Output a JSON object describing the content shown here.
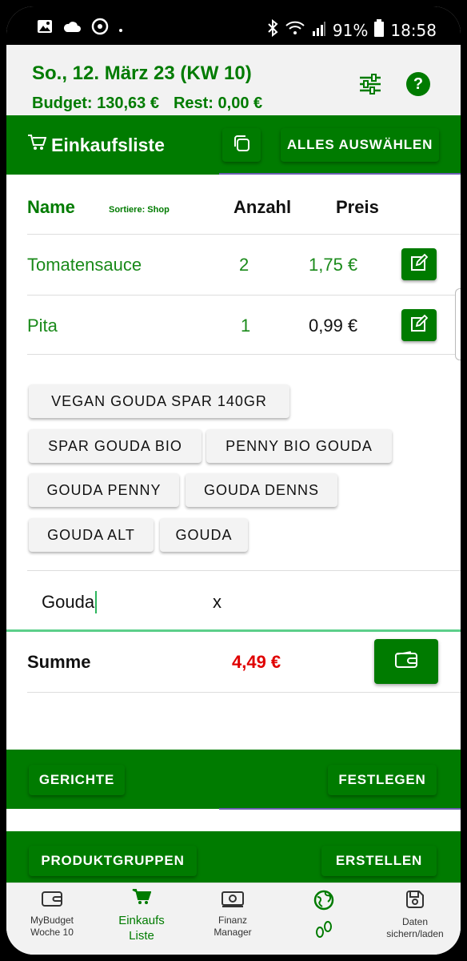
{
  "status": {
    "battery": "91%",
    "time": "18:58"
  },
  "header": {
    "date": "So., 12. März 23 (KW 10)",
    "budget": "Budget: 130,63 €",
    "rest": "Rest: 0,00 €"
  },
  "list_bar": {
    "title": "Einkaufsliste",
    "select_all": "ALLES AUSWÄHLEN"
  },
  "table": {
    "col_name": "Name",
    "sort_label": "Sortiere: Shop",
    "col_qty": "Anzahl",
    "col_price": "Preis",
    "rows": [
      {
        "name": "Tomatensauce",
        "qty": "2",
        "price": "1,75 €"
      },
      {
        "name": "Pita",
        "qty": "1",
        "price": "0,99 €"
      }
    ]
  },
  "suggestions": [
    "VEGAN GOUDA SPAR 140GR",
    "SPAR GOUDA BIO",
    "PENNY BIO GOUDA",
    "GOUDA PENNY",
    "GOUDA DENNS",
    "GOUDA ALT",
    "GOUDA"
  ],
  "input": {
    "value": "Gouda",
    "clear": "x"
  },
  "sum": {
    "label": "Summe",
    "value": "4,49 €"
  },
  "dishes_bar": {
    "left": "GERICHTE",
    "right": "FESTLEGEN"
  },
  "groups_bar": {
    "left": "PRODUKTGRUPPEN",
    "right": "ERSTELLEN"
  },
  "nav": [
    {
      "label1": "MyBudget",
      "label2": "Woche 10"
    },
    {
      "label1": "Einkaufs",
      "label2": "Liste"
    },
    {
      "label1": "Finanz",
      "label2": "Manager"
    },
    {
      "label1": "",
      "label2": ""
    },
    {
      "label1": "Daten",
      "label2": "sichern/laden"
    }
  ],
  "colors": {
    "accent": "#007b00",
    "sum_red": "#e00000",
    "chip_bg": "#f3f3f3"
  }
}
